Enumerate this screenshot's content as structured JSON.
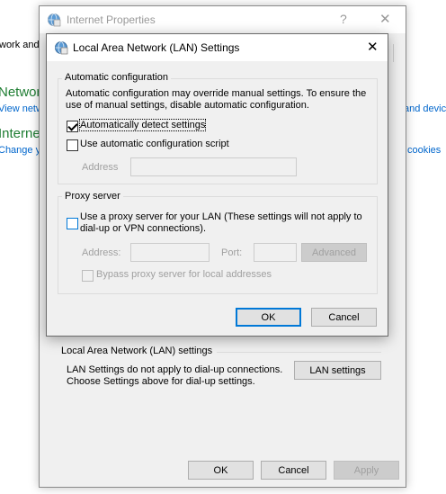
{
  "background": {
    "tab_fragment": "work and",
    "heading_network": "Networ",
    "link_view": "View netw",
    "heading_internet": "Interne",
    "link_change": "Change y",
    "link_right_1": "and devic",
    "link_right_2": "cookies"
  },
  "internet_properties": {
    "title": "Internet Properties",
    "help_glyph": "?",
    "close_glyph": "✕",
    "lan_section_title": "Local Area Network (LAN) settings",
    "lan_desc_line1": "LAN Settings do not apply to dial-up connections.",
    "lan_desc_line2": "Choose Settings above for dial-up settings.",
    "lan_settings_button": "LAN settings",
    "ok": "OK",
    "cancel": "Cancel",
    "apply": "Apply"
  },
  "lan_dialog": {
    "title": "Local Area Network (LAN) Settings",
    "close_glyph": "✕",
    "auto_config": {
      "legend": "Automatic configuration",
      "description_line1": "Automatic configuration may override manual settings.  To ensure the",
      "description_line2": "use of manual settings, disable automatic configuration.",
      "auto_detect_label": "Automatically detect settings",
      "auto_detect_checked": true,
      "use_script_label": "Use automatic configuration script",
      "use_script_checked": false,
      "address_label": "Address",
      "address_value": ""
    },
    "proxy": {
      "legend": "Proxy server",
      "use_proxy_line1": "Use a proxy server for your LAN (These settings will not apply to",
      "use_proxy_line2": "dial-up or VPN connections).",
      "use_proxy_checked": false,
      "address_label": "Address:",
      "address_value": "",
      "port_label": "Port:",
      "port_value": "",
      "advanced_button": "Advanced",
      "bypass_label": "Bypass proxy server for local addresses",
      "bypass_checked": false
    },
    "ok": "OK",
    "cancel": "Cancel"
  },
  "colors": {
    "accent": "#0078d7",
    "green_heading": "#1e7d32",
    "link": "#0066cc"
  }
}
